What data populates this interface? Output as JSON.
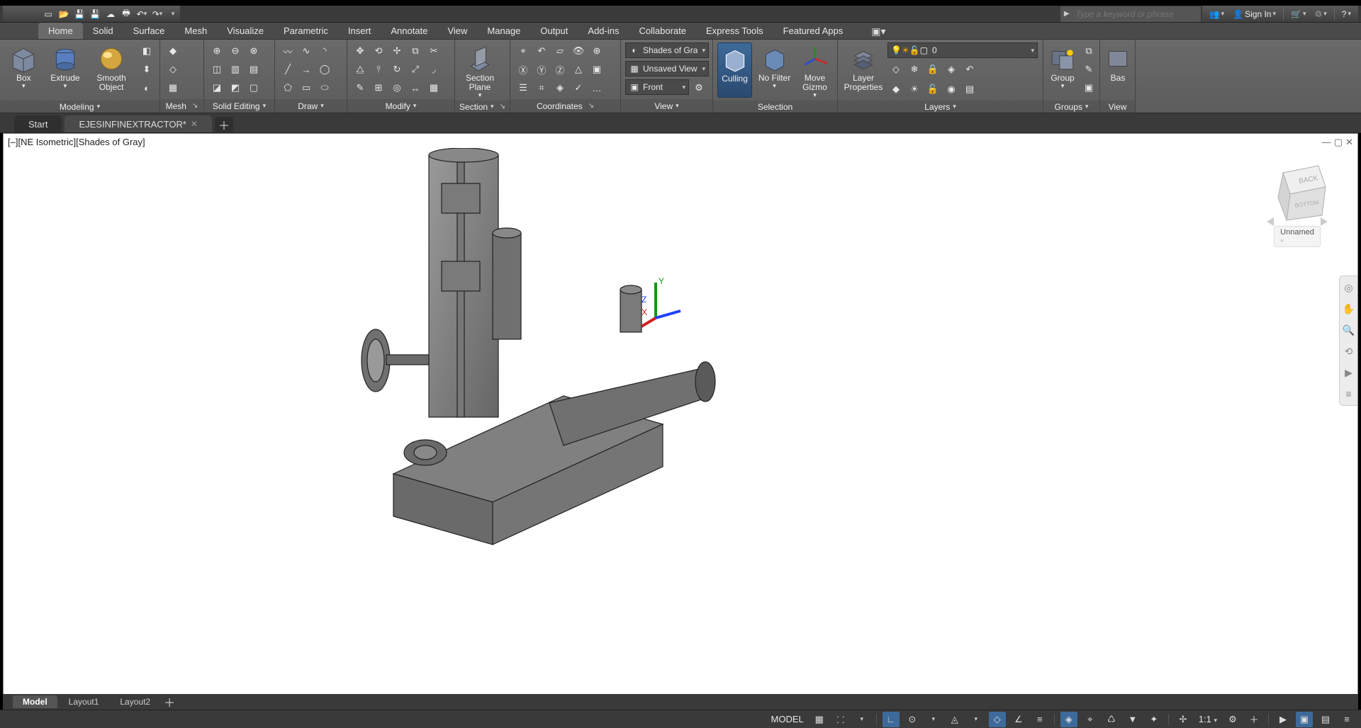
{
  "qat": {
    "search_placeholder": "Type a keyword or phrase",
    "signin": "Sign In"
  },
  "tabs": [
    "Home",
    "Solid",
    "Surface",
    "Mesh",
    "Visualize",
    "Parametric",
    "Insert",
    "Annotate",
    "View",
    "Manage",
    "Output",
    "Add-ins",
    "Collaborate",
    "Express Tools",
    "Featured Apps"
  ],
  "active_tab": "Home",
  "panels": {
    "modeling": {
      "title": "Modeling",
      "box": "Box",
      "extrude": "Extrude",
      "smooth": "Smooth Object"
    },
    "mesh": "Mesh",
    "solid_editing": "Solid Editing",
    "draw": "Draw",
    "modify": "Modify",
    "section": {
      "title": "Section",
      "btn": "Section Plane"
    },
    "coordinates": "Coordinates",
    "view": {
      "title": "View",
      "visual_style": "Shades of Gray",
      "named_view": "Unsaved View",
      "orient": "Front"
    },
    "selection": {
      "title": "Selection",
      "culling": "Culling",
      "nofilter": "No Filter",
      "movegizmo": "Move Gizmo"
    },
    "layers": {
      "title": "Layers",
      "props": "Layer Properties",
      "current": "0"
    },
    "groups": {
      "title": "Groups",
      "group": "Group"
    },
    "viewpanel": "View",
    "base": "Bas"
  },
  "filetabs": {
    "start": "Start",
    "file": "EJESINFINEXTRACTOR*",
    "file_mod": true
  },
  "viewport": {
    "label": "[–][NE Isometric][Shades of Gray]",
    "viewcube_label": "Unnamed",
    "viewcube_back": "BACK",
    "viewcube_bottom": "BOTTOM"
  },
  "layouts": [
    "Model",
    "Layout1",
    "Layout2"
  ],
  "active_layout": "Model",
  "status": {
    "space": "MODEL",
    "scale": "1:1"
  }
}
